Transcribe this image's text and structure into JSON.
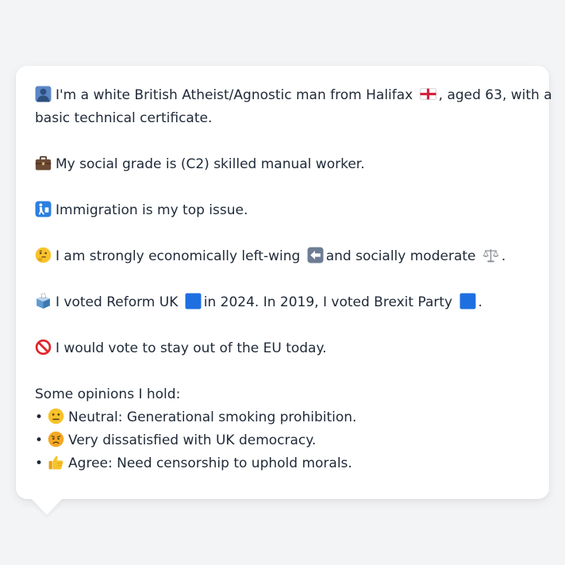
{
  "card": {
    "para1": {
      "line1": "I'm a white British Atheist/Agnostic man from Halifax",
      "line1_tail": ", aged 63, with a",
      "line2": "basic technical certificate.",
      "icons": [
        "person-silhouette-icon",
        "england-flag-icon"
      ]
    },
    "para2": {
      "text": "My social grade is (C2) skilled manual worker.",
      "icon": "briefcase-icon"
    },
    "para3": {
      "text": "Immigration is my top issue.",
      "icon": "passport-control-icon"
    },
    "para4": {
      "text_a": "I am strongly economically left-wing",
      "text_b": "and socially moderate",
      "text_c": ".",
      "icons": [
        "thinking-face-icon",
        "left-arrow-icon",
        "balance-scale-icon"
      ]
    },
    "para5": {
      "text_a": "I voted Reform UK",
      "text_b": "in 2024. In 2019, I voted Brexit Party",
      "text_c": ".",
      "icons": [
        "ballot-box-icon",
        "blue-square-icon",
        "blue-square-icon"
      ]
    },
    "para6": {
      "text": "I would vote to stay out of the EU today.",
      "icon": "prohibited-icon"
    },
    "opinions": {
      "heading": "Some opinions I hold:",
      "bullet": "•",
      "items": [
        {
          "text": "Neutral: Generational smoking prohibition.",
          "icon": "neutral-face-icon"
        },
        {
          "text": "Very dissatisfied with UK democracy.",
          "icon": "angry-face-icon"
        },
        {
          "text": "Agree: Need censorship to uphold morals.",
          "icon": "thumbs-up-icon"
        }
      ]
    }
  },
  "colors": {
    "page_background": "#f3f4f6",
    "card_background": "#ffffff",
    "text": "#1f2937",
    "flag_blue": "#1e6fe0"
  }
}
